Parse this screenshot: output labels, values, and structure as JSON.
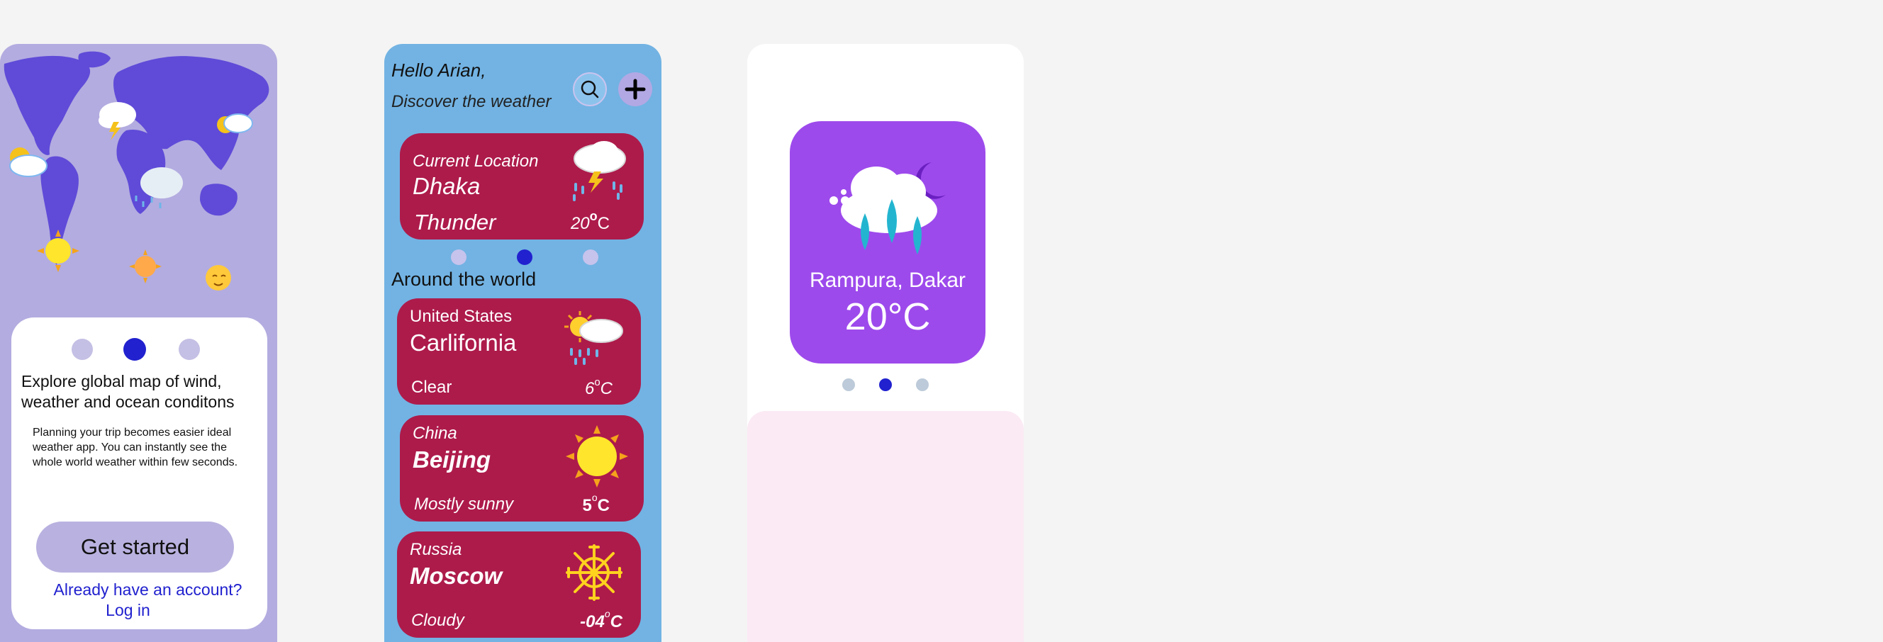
{
  "onboarding": {
    "headline": "Explore global map of wind, weather and ocean conditons",
    "description": "Planning your trip becomes easier ideal weather app. You can instantly see the whole world weather within few seconds.",
    "cta_label": "Get started",
    "account_prompt": "Already have an account?",
    "login_label": "Log in",
    "page_indicator": {
      "current": 2,
      "total": 3
    }
  },
  "dashboard": {
    "greeting": "Hello Arian,",
    "subtitle": "Discover the weather",
    "search_icon": "search-icon",
    "add_icon": "plus-icon",
    "current": {
      "label": "Current Location",
      "city": "Dhaka",
      "condition": "Thunder",
      "temp": "20",
      "unit": "C",
      "icon": "thunderstorm-icon"
    },
    "page_indicator": {
      "current": 2,
      "total": 3
    },
    "section_title": "Around the world",
    "cities": [
      {
        "country": "United States",
        "city": "Carlifornia",
        "condition": "Clear",
        "temp": "6",
        "unit": "C",
        "icon": "sun-cloud-rain-icon"
      },
      {
        "country": "China",
        "city": "Beijing",
        "condition": "Mostly sunny",
        "temp": "5",
        "unit": "C",
        "icon": "sun-icon"
      },
      {
        "country": "Russia",
        "city": "Moscow",
        "condition": "Cloudy",
        "temp": "-04",
        "unit": "C",
        "icon": "snowflake-sun-icon"
      }
    ]
  },
  "detail": {
    "place": "Rampura, Dakar",
    "temperature": "20°C",
    "icon": "night-rain-icon",
    "page_indicator": {
      "current": 2,
      "total": 3
    }
  },
  "colors": {
    "background": "#f4f4f4",
    "onboarding_bg": "#b3ace0",
    "dashboard_bg": "#72b3e3",
    "card_bg": "#ad1b4b",
    "detail_tile": "#9d4aec",
    "detail_panel": "#fbeaf4",
    "accent": "#2121cf"
  }
}
